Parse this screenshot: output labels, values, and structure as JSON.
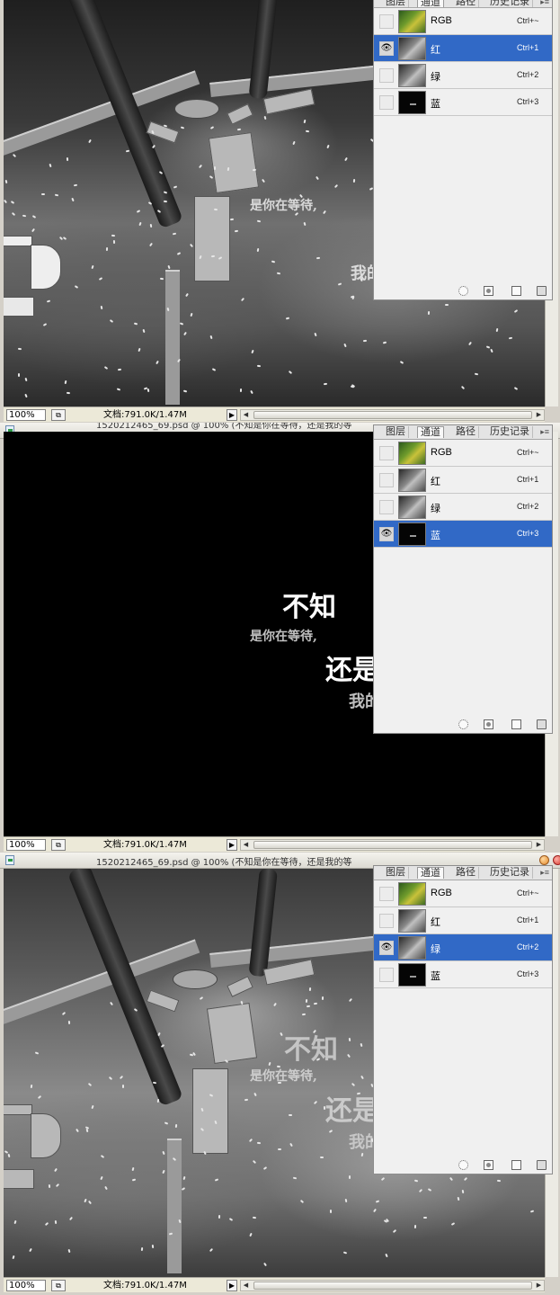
{
  "panels": [
    {
      "title": "",
      "zoom": "100%",
      "doc_info": "文档:791.0K/1.47M",
      "channels": [
        {
          "name": "RGB",
          "shortcut": "Ctrl+~",
          "thumb": "rgb",
          "visible": false,
          "selected": false
        },
        {
          "name": "红",
          "shortcut": "Ctrl+1",
          "thumb": "gray",
          "visible": true,
          "selected": true
        },
        {
          "name": "绿",
          "shortcut": "Ctrl+2",
          "thumb": "gray",
          "visible": false,
          "selected": false
        },
        {
          "name": "蓝",
          "shortcut": "Ctrl+3",
          "thumb": "dark",
          "visible": false,
          "selected": false
        }
      ],
      "overlay": {
        "line1": "",
        "line2": "是你在等待,",
        "line3": "",
        "line4": "我的"
      }
    },
    {
      "title": "1520212465_69.psd @ 100% (不知是你在等待，还是我的等",
      "zoom": "100%",
      "doc_info": "文档:791.0K/1.47M",
      "channels": [
        {
          "name": "RGB",
          "shortcut": "Ctrl+~",
          "thumb": "rgb",
          "visible": false,
          "selected": false
        },
        {
          "name": "红",
          "shortcut": "Ctrl+1",
          "thumb": "gray",
          "visible": false,
          "selected": false
        },
        {
          "name": "绿",
          "shortcut": "Ctrl+2",
          "thumb": "gray",
          "visible": false,
          "selected": false
        },
        {
          "name": "蓝",
          "shortcut": "Ctrl+3",
          "thumb": "dark",
          "visible": true,
          "selected": true
        }
      ],
      "overlay": {
        "line1": "不知",
        "line2": "是你在等待,",
        "line3": "还是",
        "line4": "我的"
      }
    },
    {
      "title": "1520212465_69.psd @ 100% (不知是你在等待，还是我的等",
      "zoom": "100%",
      "doc_info": "文档:791.0K/1.47M",
      "channels": [
        {
          "name": "RGB",
          "shortcut": "Ctrl+~",
          "thumb": "rgb",
          "visible": false,
          "selected": false
        },
        {
          "name": "红",
          "shortcut": "Ctrl+1",
          "thumb": "gray",
          "visible": false,
          "selected": false
        },
        {
          "name": "绿",
          "shortcut": "Ctrl+2",
          "thumb": "gray",
          "visible": true,
          "selected": true
        },
        {
          "name": "蓝",
          "shortcut": "Ctrl+3",
          "thumb": "dark",
          "visible": false,
          "selected": false
        }
      ],
      "overlay": {
        "line1": "不知",
        "line2": "是你在等待,",
        "line3": "还是",
        "line4": "我的"
      }
    }
  ],
  "panel_tabs": [
    "图层",
    "通道",
    "路径",
    "历史记录"
  ],
  "active_tab": "通道",
  "icons": {
    "eye": "eye-icon",
    "load_selection": "dotted-circle-icon",
    "save_selection": "mask-icon",
    "new_channel": "new-page-icon",
    "delete_channel": "trash-icon"
  },
  "colors": {
    "selection": "#3169c6",
    "panel_bg": "#f0f0f0"
  }
}
